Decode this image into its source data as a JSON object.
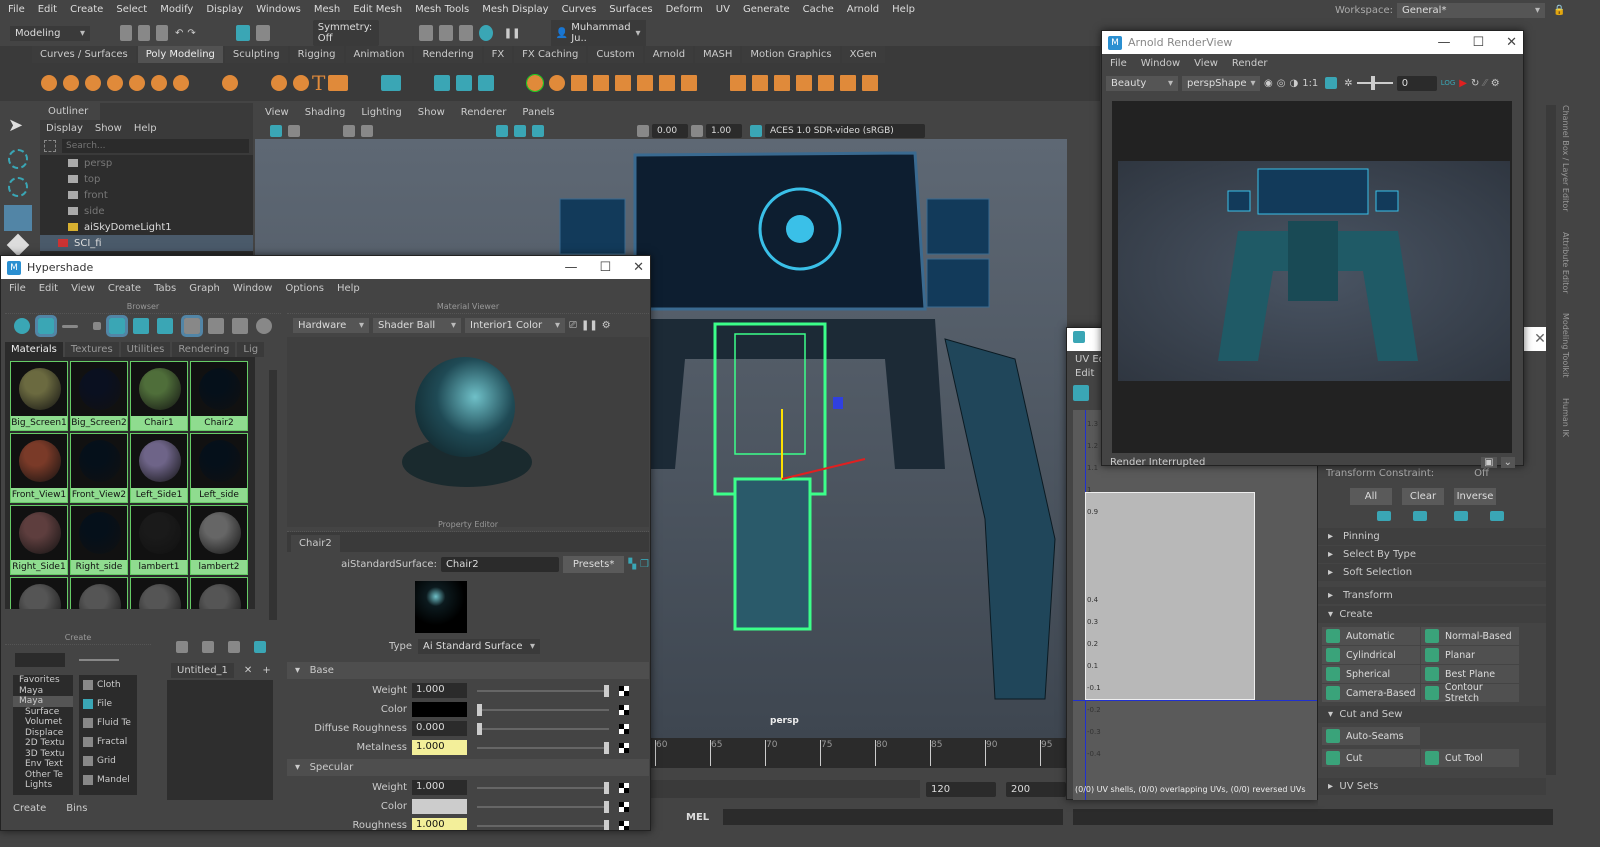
{
  "menubar": {
    "items": [
      "File",
      "Edit",
      "Create",
      "Select",
      "Modify",
      "Display",
      "Windows",
      "Mesh",
      "Edit Mesh",
      "Mesh Tools",
      "Mesh Display",
      "Curves",
      "Surfaces",
      "Deform",
      "UV",
      "Generate",
      "Cache",
      "Arnold",
      "Help"
    ],
    "workspace_label": "Workspace:",
    "workspace_value": "General*"
  },
  "statusline": {
    "mode": "Modeling",
    "symmetry": "Symmetry: Off",
    "user": "Muhammad Ju.."
  },
  "shelf": {
    "tabs": [
      "Curves / Surfaces",
      "Poly Modeling",
      "Sculpting",
      "Rigging",
      "Animation",
      "Rendering",
      "FX",
      "FX Caching",
      "Custom",
      "Arnold",
      "MASH",
      "Motion Graphics",
      "XGen"
    ],
    "active": "Poly Modeling"
  },
  "outliner": {
    "title": "Outliner",
    "menu": [
      "Display",
      "Show",
      "Help"
    ],
    "search_placeholder": "Search...",
    "items": [
      "persp",
      "top",
      "front",
      "side",
      "aiSkyDomeLight1",
      "SCI_fi"
    ]
  },
  "viewport": {
    "menu": [
      "View",
      "Shading",
      "Lighting",
      "Show",
      "Renderer",
      "Panels"
    ],
    "val1": "0.00",
    "val2": "1.00",
    "colorspace": "ACES 1.0 SDR-video (sRGB)",
    "camera": "persp"
  },
  "timeline": {
    "ticks": [
      "60",
      "65",
      "70",
      "75",
      "80",
      "85",
      "90",
      "95"
    ],
    "range_end": "120",
    "range_max": "200",
    "mel": "MEL"
  },
  "hypershade": {
    "title": "Hypershade",
    "menu": [
      "File",
      "Edit",
      "View",
      "Create",
      "Tabs",
      "Graph",
      "Window",
      "Options",
      "Help"
    ],
    "browser_label": "Browser",
    "tabs": [
      "Materials",
      "Textures",
      "Utilities",
      "Rendering",
      "Lig"
    ],
    "materials": [
      {
        "name": "Big_Screen1",
        "color": "#6b6a40"
      },
      {
        "name": "Big_Screen2",
        "color": "#0a1020"
      },
      {
        "name": "Chair1",
        "color": "#4f6e3a"
      },
      {
        "name": "Chair2",
        "color": "#05101a"
      },
      {
        "name": "Front_View1",
        "color": "#7a3a28"
      },
      {
        "name": "Front_View2",
        "color": "#05101a"
      },
      {
        "name": "Left_Side1",
        "color": "#6e6488"
      },
      {
        "name": "Left_side",
        "color": "#05101a"
      },
      {
        "name": "Right_Side1",
        "color": "#5e3e3e"
      },
      {
        "name": "Right_side",
        "color": "#05101a"
      },
      {
        "name": "lambert1",
        "color": "#1a1a1a"
      },
      {
        "name": "lambert2",
        "color": "#666"
      },
      {
        "name": "",
        "color": "#555"
      },
      {
        "name": "",
        "color": "#555"
      },
      {
        "name": "",
        "color": "#555"
      },
      {
        "name": "",
        "color": "#555"
      }
    ],
    "viewer_label": "Material Viewer",
    "viewer_renderer": "Hardware",
    "viewer_geo": "Shader Ball",
    "viewer_env": "Interior1 Color",
    "create_label": "Create",
    "create_tree": [
      "Favorites",
      "Maya",
      "Maya",
      "Surface",
      "Volumet",
      "Displace",
      "2D Textu",
      "3D Textu",
      "Env Text",
      "Other Te",
      "Lights"
    ],
    "create_list": [
      "Cloth",
      "File",
      "Fluid Te",
      "Fractal",
      "Grid",
      "Mandel"
    ],
    "graph_tab": "Untitled_1",
    "graph_add": "+",
    "bottom_tabs": [
      "Create",
      "Bins"
    ],
    "prop_label": "Property Editor",
    "prop_tab": "Chair2",
    "shader_type_label": "aiStandardSurface:",
    "shader_name": "Chair2",
    "presets": "Presets*",
    "type_label": "Type",
    "type_value": "Ai Standard Surface",
    "base_label": "Base",
    "base": [
      {
        "name": "Weight",
        "value": "1.000"
      },
      {
        "name": "Color",
        "value": ""
      },
      {
        "name": "Diffuse Roughness",
        "value": "0.000"
      },
      {
        "name": "Metalness",
        "value": "1.000"
      }
    ],
    "spec_label": "Specular",
    "spec": [
      {
        "name": "Weight",
        "value": "1.000"
      },
      {
        "name": "Color",
        "value": ""
      },
      {
        "name": "Roughness",
        "value": "1.000"
      }
    ]
  },
  "renderview": {
    "title": "Arnold RenderView",
    "menu": [
      "File",
      "Window",
      "View",
      "Render"
    ],
    "aov": "Beauty",
    "camera": "perspShape",
    "ratio": "1:1",
    "exposure": "0",
    "log": "LOG",
    "status": "Render Interrupted"
  },
  "uveditor": {
    "title": "UV Edi",
    "menu": "Edit",
    "vticks": [
      "1.3",
      "1.2",
      "1.1",
      "1",
      "0.9",
      "0.4",
      "0.3",
      "0.2",
      "0.1",
      "-0.1",
      "-0.2",
      "-0.3",
      "-0.4"
    ],
    "status": "(0/0) UV shells, (0/0) overlapping UVs, (0/0) reversed UVs"
  },
  "mtk": {
    "constraint_label": "Transform Constraint:",
    "constraint_value": "Off",
    "buttons": [
      "All",
      "Clear",
      "Inverse"
    ],
    "sections": [
      "Pinning",
      "Select By Type",
      "Soft Selection",
      "Transform"
    ],
    "create_label": "Create",
    "create_items": [
      "Automatic",
      "Normal-Based",
      "Cylindrical",
      "Planar",
      "Spherical",
      "Best Plane",
      "Camera-Based",
      "Contour Stretch"
    ],
    "cutsew_label": "Cut and Sew",
    "cutsew_items": [
      "Auto-Seams",
      "Cut",
      "Cut Tool"
    ],
    "uvsets_label": "UV Sets"
  },
  "side_tabs": [
    "Channel Box / Layer Editor",
    "Attribute Editor",
    "Modeling Toolkit",
    "Human IK"
  ],
  "colors": {
    "accent": "#5285a6",
    "swatch_label": "#8fdc8f",
    "wire": "#3cff8a"
  }
}
